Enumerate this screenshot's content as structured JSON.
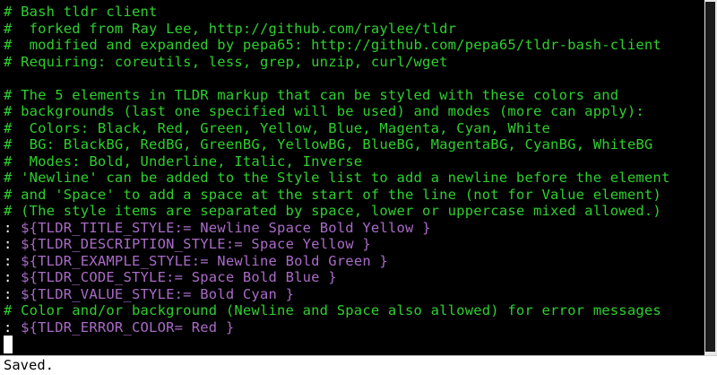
{
  "editor": {
    "lines": [
      {
        "text": "# Bash tldr client",
        "kind": "comment"
      },
      {
        "text": "#  forked from Ray Lee, http://github.com/raylee/tldr",
        "kind": "comment"
      },
      {
        "text": "#  modified and expanded by pepa65: http://github.com/pepa65/tldr-bash-client",
        "kind": "comment"
      },
      {
        "text": "# Requiring: coreutils, less, grep, unzip, curl/wget",
        "kind": "comment"
      },
      {
        "text": "",
        "kind": "blank"
      },
      {
        "text": "# The 5 elements in TLDR markup that can be styled with these colors and",
        "kind": "comment"
      },
      {
        "text": "# backgrounds (last one specified will be used) and modes (more can apply):",
        "kind": "comment"
      },
      {
        "text": "#  Colors: Black, Red, Green, Yellow, Blue, Magenta, Cyan, White",
        "kind": "comment"
      },
      {
        "text": "#  BG: BlackBG, RedBG, GreenBG, YellowBG, BlueBG, MagentaBG, CyanBG, WhiteBG",
        "kind": "comment"
      },
      {
        "text": "#  Modes: Bold, Underline, Italic, Inverse",
        "kind": "comment"
      },
      {
        "text": "# 'Newline' can be added to the Style list to add a newline before the element",
        "kind": "comment"
      },
      {
        "text": "# and 'Space' to add a space at the start of the line (not for Value element)",
        "kind": "comment"
      },
      {
        "text": "# (The style items are separated by space, lower or uppercase mixed allowed.)",
        "kind": "comment"
      },
      {
        "prefix": ":",
        "text": " ${TLDR_TITLE_STYLE:= Newline Space Bold Yellow }",
        "kind": "code"
      },
      {
        "prefix": ":",
        "text": " ${TLDR_DESCRIPTION_STYLE:= Space Yellow }",
        "kind": "code"
      },
      {
        "prefix": ":",
        "text": " ${TLDR_EXAMPLE_STYLE:= Newline Bold Green }",
        "kind": "code"
      },
      {
        "prefix": ":",
        "text": " ${TLDR_CODE_STYLE:= Space Bold Blue }",
        "kind": "code"
      },
      {
        "prefix": ":",
        "text": " ${TLDR_VALUE_STYLE:= Bold Cyan }",
        "kind": "code"
      },
      {
        "text": "# Color and/or background (Newline and Space also allowed) for error messages",
        "kind": "comment"
      },
      {
        "prefix": ":",
        "text": " ${TLDR_ERROR_COLOR= Red }",
        "kind": "code"
      }
    ]
  },
  "status": {
    "message": "Saved."
  },
  "colors": {
    "comment": "#2fcf2f",
    "code": "#a96bc7",
    "background": "#000000",
    "statusbar": "#ffffff"
  }
}
